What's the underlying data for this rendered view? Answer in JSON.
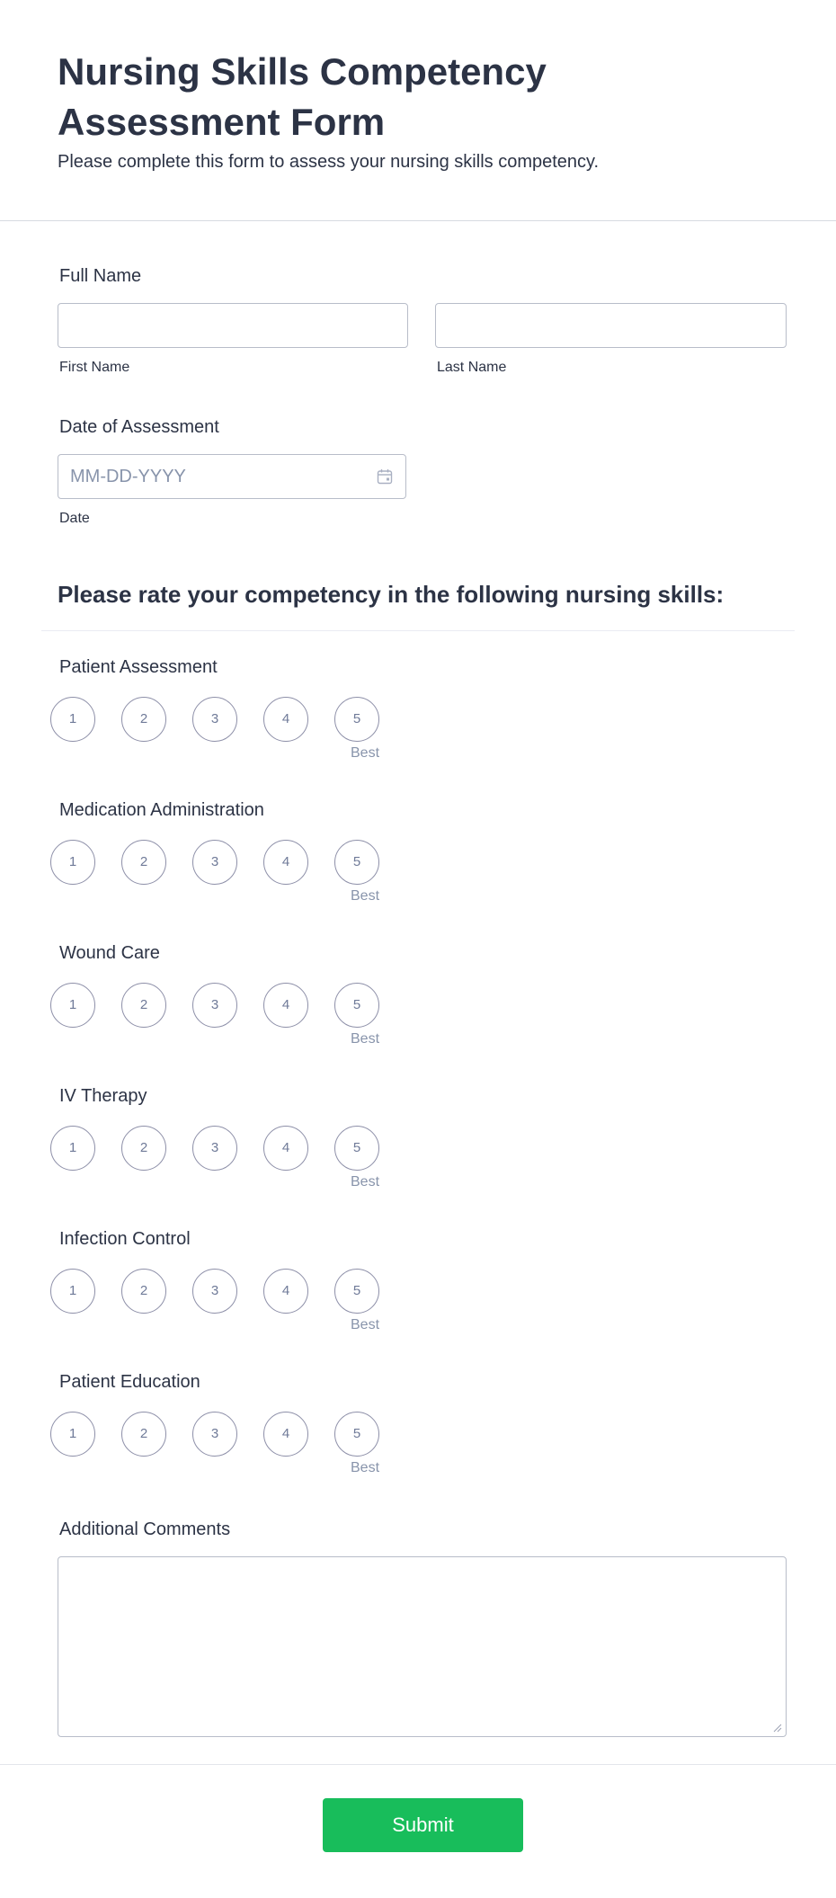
{
  "header": {
    "title": "Nursing Skills Competency Assessment Form",
    "subtitle": "Please complete this form to assess your nursing skills competency."
  },
  "full_name": {
    "label": "Full Name",
    "first_label": "First Name",
    "last_label": "Last Name",
    "first_value": "",
    "last_value": ""
  },
  "date": {
    "label": "Date of Assessment",
    "placeholder": "MM-DD-YYYY",
    "sublabel": "Date",
    "icon": "calendar-icon"
  },
  "ratings_section": {
    "heading": "Please rate your competency in the following nursing skills:",
    "scale": [
      "1",
      "2",
      "3",
      "4",
      "5"
    ],
    "best_label": "Best",
    "skills": [
      "Patient Assessment",
      "Medication Administration",
      "Wound Care",
      "IV Therapy",
      "Infection Control",
      "Patient Education"
    ]
  },
  "comments": {
    "label": "Additional Comments",
    "value": ""
  },
  "submit": {
    "label": "Submit",
    "color": "#18bd5b"
  }
}
